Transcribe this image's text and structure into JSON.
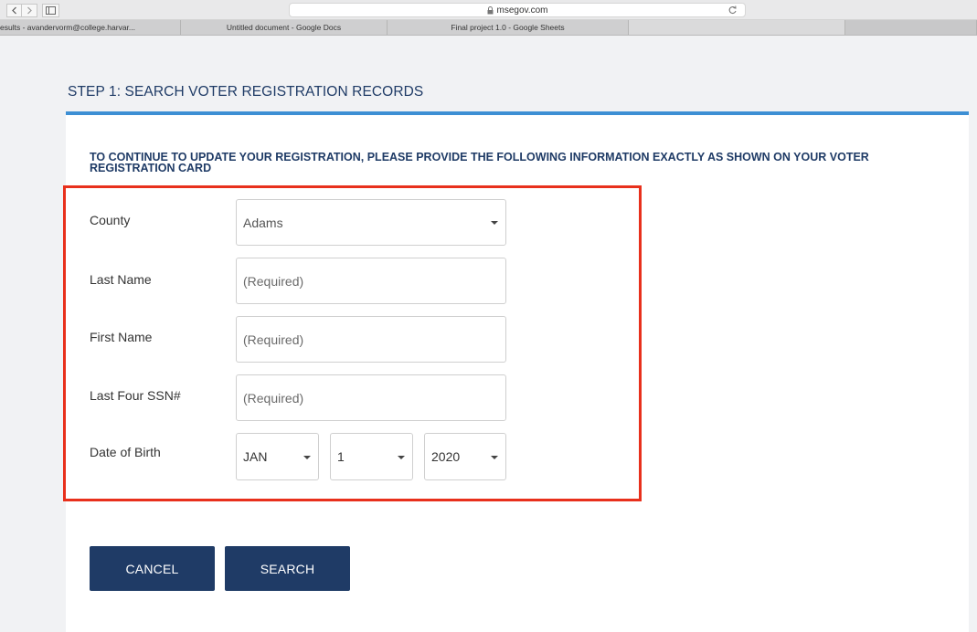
{
  "browser": {
    "url": "msegov.com",
    "tabs": [
      "esults - avandervorm@college.harvar...",
      "Untitled document - Google Docs",
      "Final project 1.0 - Google Sheets",
      "",
      ""
    ]
  },
  "page": {
    "step_title": "STEP 1: SEARCH VOTER REGISTRATION RECORDS",
    "instructions": "TO CONTINUE TO UPDATE YOUR REGISTRATION, PLEASE PROVIDE THE FOLLOWING INFORMATION EXACTLY AS SHOWN ON YOUR VOTER REGISTRATION CARD"
  },
  "form": {
    "county": {
      "label": "County",
      "value": "Adams"
    },
    "last_name": {
      "label": "Last Name",
      "placeholder": "(Required)"
    },
    "first_name": {
      "label": "First Name",
      "placeholder": "(Required)"
    },
    "ssn": {
      "label": "Last Four SSN#",
      "placeholder": "(Required)"
    },
    "dob": {
      "label": "Date of Birth",
      "month": "JAN",
      "day": "1",
      "year": "2020"
    }
  },
  "buttons": {
    "cancel": "CANCEL",
    "search": "SEARCH"
  },
  "colors": {
    "navy": "#1f3b66",
    "accent_rule": "#3d8fd4",
    "highlight": "#e8301c"
  }
}
